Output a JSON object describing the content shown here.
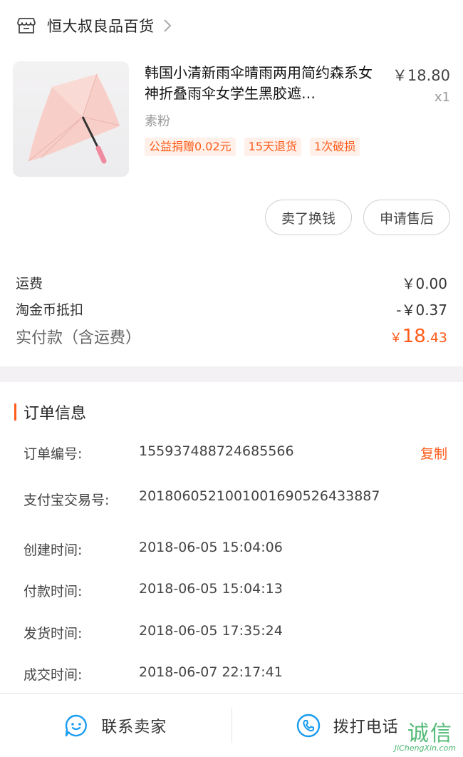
{
  "shop": {
    "name": "恒大叔良品百货",
    "icon": "store-icon",
    "chevron": "chevron-right-icon"
  },
  "product": {
    "title": "韩国小清新雨伞晴雨两用简约森系女神折叠雨伞女学生黑胶遮…",
    "price": "￥18.80",
    "qty": "x1",
    "sku": "素粉",
    "tags": [
      "公益捐赠0.02元",
      "15天退货",
      "1次破损"
    ]
  },
  "actions": {
    "sell_label": "卖了换钱",
    "aftersale_label": "申请售后"
  },
  "fees": {
    "shipping_label": "运费",
    "shipping_value": "￥0.00",
    "coin_label": "淘金币抵扣",
    "coin_value": "-￥0.37",
    "total_label": "实付款（含运费）",
    "total_currency": "￥",
    "total_int": "18",
    "total_dec": ".43"
  },
  "order_info": {
    "title": "订单信息",
    "order_no_label": "订单编号:",
    "order_no": "155937488724685566",
    "copy_label": "复制",
    "alipay_label": "支付宝交易号:",
    "alipay_no": "2018060521001001690526433887",
    "created_label": "创建时间:",
    "created": "2018-06-05 15:04:06",
    "paid_label": "付款时间:",
    "paid": "2018-06-05 15:04:13",
    "shipped_label": "发货时间:",
    "shipped": "2018-06-05 17:35:24",
    "completed_label": "成交时间:",
    "completed": "2018-06-07 22:17:41"
  },
  "bottom": {
    "contact_label": "联系卖家",
    "contact_icon": "chat-bubble-icon",
    "call_label": "拨打电话",
    "call_icon": "phone-icon"
  },
  "watermark": {
    "main": "诚信",
    "sub": "JiChengXin.com"
  },
  "colors": {
    "accent": "#ff5b1a",
    "icon_blue": "#1a9cf0"
  }
}
